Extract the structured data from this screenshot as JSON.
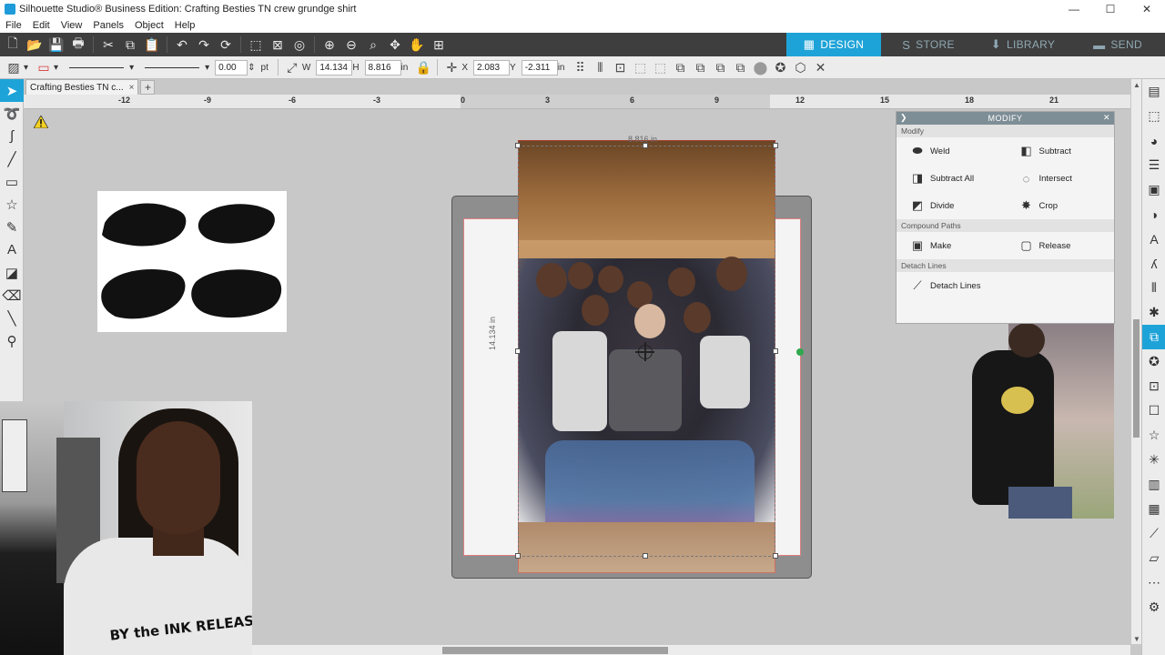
{
  "window": {
    "title": "Silhouette Studio® Business Edition: Crafting Besties TN crew grundge shirt",
    "min": "—",
    "max": "☐",
    "close": "✕"
  },
  "menu": [
    "File",
    "Edit",
    "View",
    "Panels",
    "Object",
    "Help"
  ],
  "nav_tabs": [
    {
      "label": "DESIGN",
      "icon": "grid-icon",
      "active": true
    },
    {
      "label": "STORE",
      "icon": "store-icon",
      "active": false
    },
    {
      "label": "LIBRARY",
      "icon": "library-icon",
      "active": false
    },
    {
      "label": "SEND",
      "icon": "cutter-icon",
      "active": false
    }
  ],
  "toolbar2": {
    "line_width": "0.00",
    "line_unit": "pt",
    "w_label": "W",
    "w_value": "14.134",
    "h_label": "H",
    "h_value": "8.816",
    "size_unit": "in",
    "x_label": "X",
    "x_value": "2.083",
    "y_label": "Y",
    "y_value": "-2.311",
    "pos_unit": "in"
  },
  "doc_tab": {
    "label": "Crafting Besties TN c...",
    "close": "×",
    "add": "+"
  },
  "ruler": {
    "labels": [
      "-12",
      "-9",
      "-6",
      "-3",
      "0",
      "3",
      "6",
      "9",
      "12",
      "15",
      "18",
      "21"
    ]
  },
  "selection": {
    "width_label": "8.816 in",
    "height_label": "14.134 in"
  },
  "modify_panel": {
    "title": "MODIFY",
    "section_modify": "Modify",
    "buttons": [
      "Weld",
      "Subtract",
      "Subtract All",
      "Intersect",
      "Divide",
      "Crop"
    ],
    "section_compound": "Compound Paths",
    "compound_buttons": [
      "Make",
      "Release"
    ],
    "section_detach": "Detach Lines",
    "detach_button": "Detach Lines"
  },
  "webcam": {
    "shirt_text": "BY the INK RELEASE for I got m"
  },
  "colors": {
    "accent": "#1ea3d8",
    "toolbar_dark": "#3e3e3e",
    "panel_header": "#7e8e96",
    "rotate_handle": "#2fa84f"
  }
}
